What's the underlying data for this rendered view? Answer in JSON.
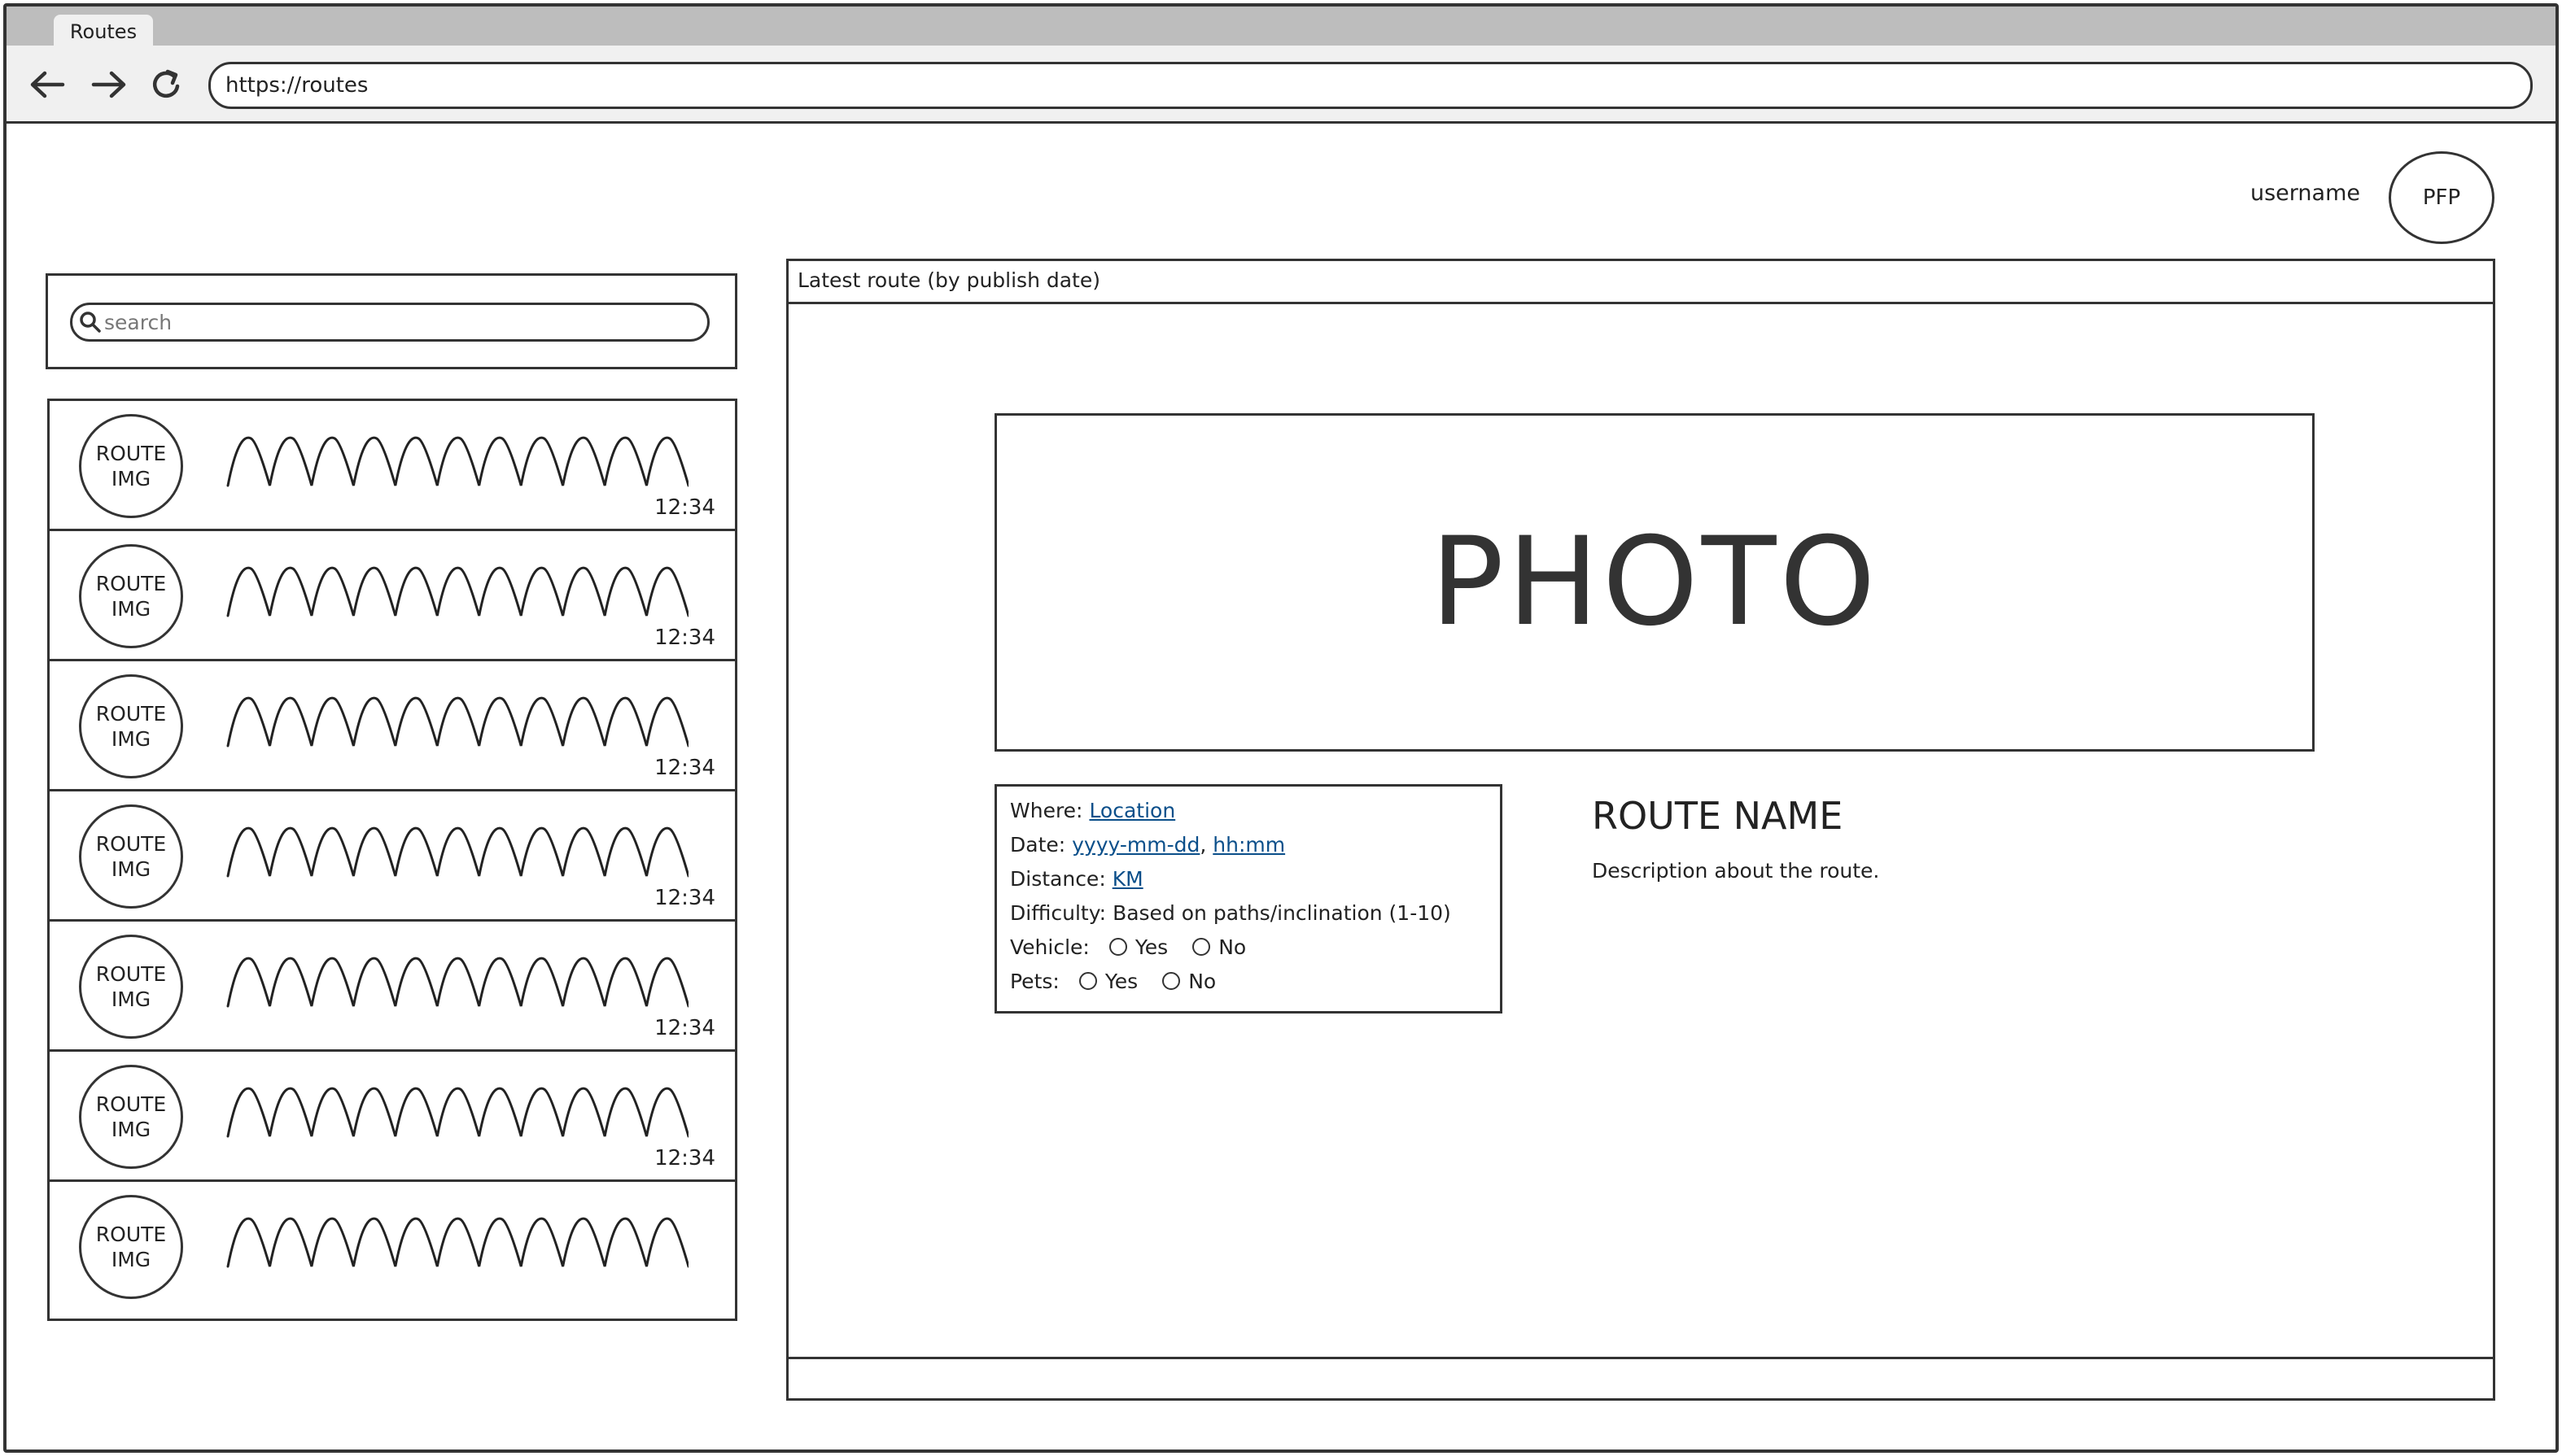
{
  "browser": {
    "tab_title": "Routes",
    "url": "https://routes"
  },
  "header": {
    "username": "username",
    "avatar_label": "PFP"
  },
  "search": {
    "placeholder": "search"
  },
  "routes": [
    {
      "img_line1": "ROUTE",
      "img_line2": "IMG",
      "time": "12:34"
    },
    {
      "img_line1": "ROUTE",
      "img_line2": "IMG",
      "time": "12:34"
    },
    {
      "img_line1": "ROUTE",
      "img_line2": "IMG",
      "time": "12:34"
    },
    {
      "img_line1": "ROUTE",
      "img_line2": "IMG",
      "time": "12:34"
    },
    {
      "img_line1": "ROUTE",
      "img_line2": "IMG",
      "time": "12:34"
    },
    {
      "img_line1": "ROUTE",
      "img_line2": "IMG",
      "time": "12:34"
    },
    {
      "img_line1": "ROUTE",
      "img_line2": "IMG",
      "time": ""
    }
  ],
  "panel": {
    "title": "Latest route (by publish date)",
    "photo_label": "PHOTO"
  },
  "details": {
    "where_label": "Where:",
    "where_value": "Location",
    "date_label": "Date:",
    "date_value": "yyyy-mm-dd",
    "date_sep": ",",
    "time_value": "hh:mm",
    "distance_label": "Distance:",
    "distance_value": "KM",
    "difficulty_label": "Difficulty:",
    "difficulty_value": "Based on paths/inclination (1-10)",
    "vehicle_label": "Vehicle:",
    "pets_label": "Pets:",
    "yes_label": "Yes",
    "no_label": "No"
  },
  "route": {
    "name": "ROUTE NAME",
    "description": "Description about the route."
  },
  "icons": {
    "back": "arrow-left-icon",
    "forward": "arrow-right-icon",
    "reload": "reload-icon",
    "search": "search-icon"
  }
}
